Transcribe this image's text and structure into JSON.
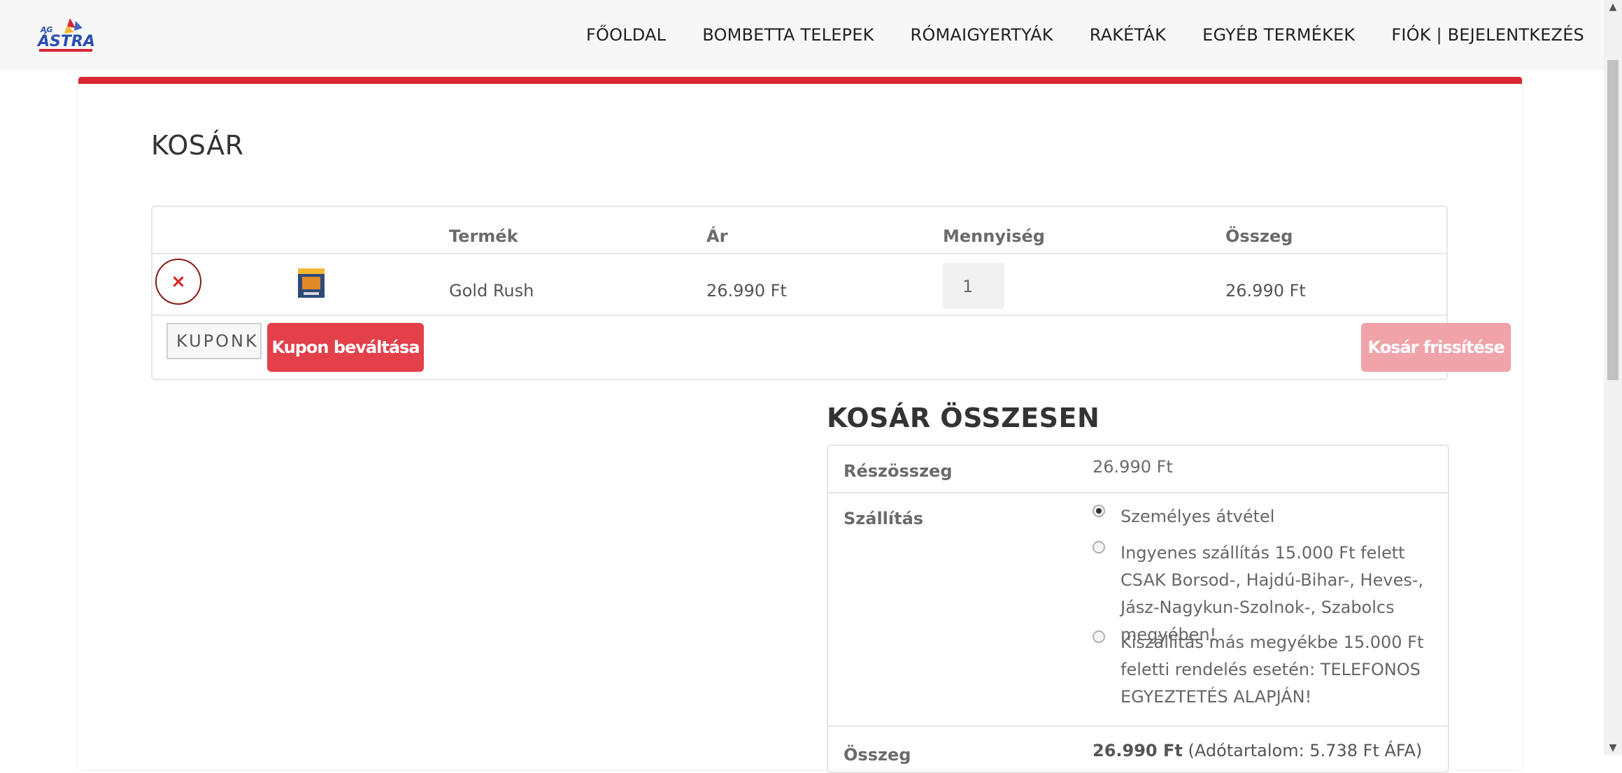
{
  "header": {
    "logo_text": "ASTRA",
    "nav": [
      "FŐOLDAL",
      "BOMBETTA TELEPEK",
      "RÓMAIGYERTYÁK",
      "RAKÉTÁK",
      "EGYÉB TERMÉKEK",
      "FIÓK | BEJELENTKEZÉS"
    ]
  },
  "cart": {
    "title": "KOSÁR",
    "columns": {
      "product": "Termék",
      "price": "Ár",
      "quantity": "Mennyiség",
      "total": "Összeg"
    },
    "items": [
      {
        "remove": "×",
        "name": "Gold Rush",
        "price": "26.990 Ft",
        "quantity": "1",
        "total": "26.990 Ft"
      }
    ],
    "coupon_placeholder": "KUPONK",
    "coupon_button": "Kupon beváltása",
    "update_button": "Kosár frissítése"
  },
  "totals": {
    "title": "KOSÁR ÖSSZESEN",
    "subtotal_label": "Részösszeg",
    "subtotal_value": "26.990 Ft",
    "shipping_label": "Szállítás",
    "shipping_options": [
      {
        "label": "Személyes átvétel",
        "checked": true
      },
      {
        "label": "Ingyenes szállítás 15.000 Ft felett CSAK Borsod-, Hajdú-Bihar-, Heves-, Jász-Nagykun-Szolnok-, Szabolcs megyében!",
        "checked": false
      },
      {
        "label": "Kiszállítás más megyékbe 15.000 Ft feletti rendelés esetén: TELEFONOS EGYEZTETÉS ALAPJÁN!",
        "checked": false
      }
    ],
    "total_label": "Összeg",
    "total_value": "26.990 Ft",
    "tax_note": "(Adótartalom: 5.738 Ft ÁFA)"
  },
  "colors": {
    "accent": "#d92631",
    "button": "#e3404a",
    "button_disabled": "#f0a3a8"
  }
}
